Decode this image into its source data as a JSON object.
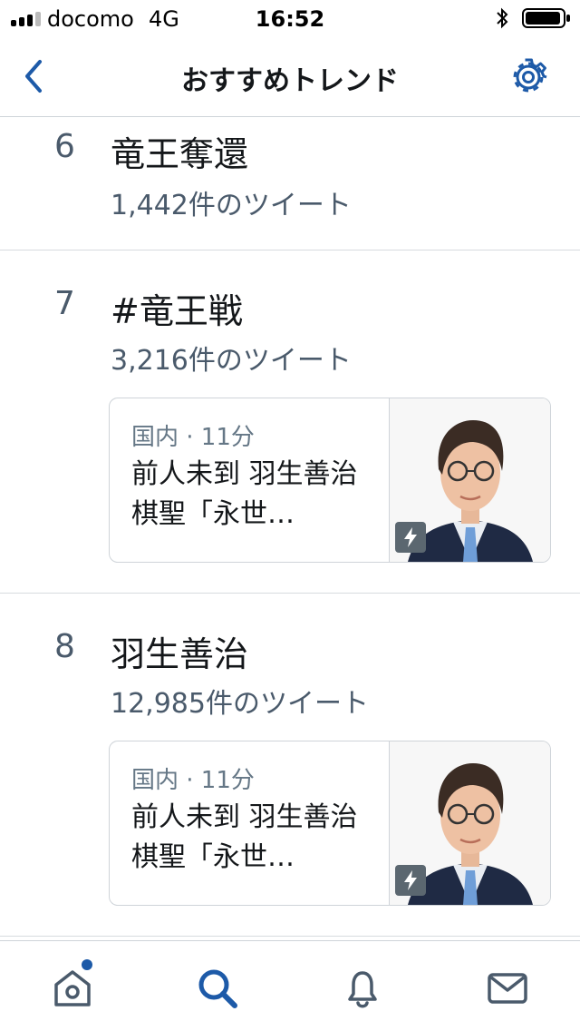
{
  "colors": {
    "accent": "#1d5aa8",
    "text_primary": "#14171a",
    "text_secondary": "#4a5a6b",
    "divider": "#d7dbdf"
  },
  "status_bar": {
    "carrier": "docomo",
    "network": "4G",
    "time": "16:52",
    "icons": [
      "signal-icon",
      "bluetooth-icon",
      "battery-icon"
    ]
  },
  "nav": {
    "title": "おすすめトレンド",
    "back_icon": "chevron-left-icon",
    "settings_icon": "gear-icon"
  },
  "trends": [
    {
      "rank": "6",
      "term": "竜王奪還",
      "count": "1,442件のツイート"
    },
    {
      "rank": "7",
      "term": "#竜王戦",
      "count": "3,216件のツイート",
      "news": {
        "meta": "国内 · 11分",
        "headline": "前人未到 羽生善治棋聖「永世…"
      }
    },
    {
      "rank": "8",
      "term": "羽生善治",
      "count": "12,985件のツイート",
      "news": {
        "meta": "国内 · 11分",
        "headline": "前人未到 羽生善治棋聖「永世…"
      }
    }
  ],
  "tab_bar": {
    "tabs": [
      {
        "name": "home",
        "icon": "home-icon",
        "active": false,
        "has_badge": true
      },
      {
        "name": "search",
        "icon": "search-icon",
        "active": true
      },
      {
        "name": "notifications",
        "icon": "bell-icon",
        "active": false
      },
      {
        "name": "messages",
        "icon": "envelope-icon",
        "active": false
      }
    ]
  }
}
